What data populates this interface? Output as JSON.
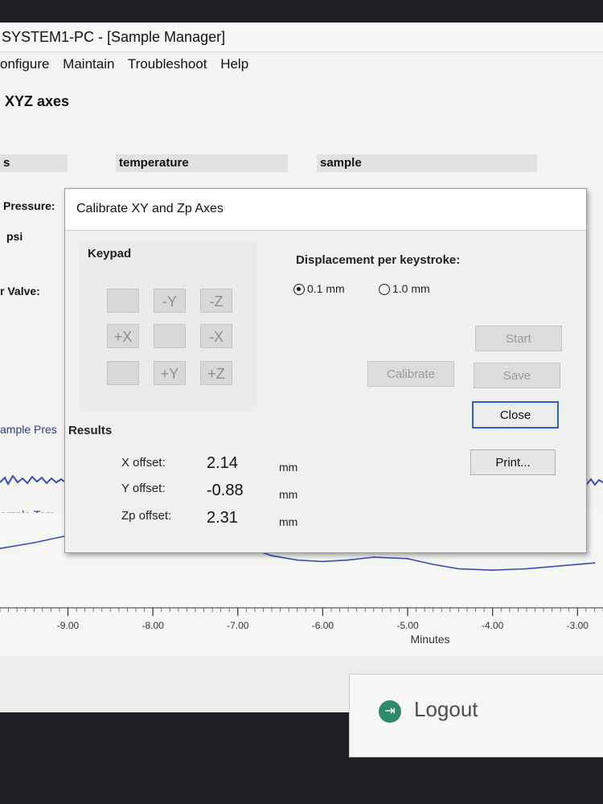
{
  "window": {
    "title": "SYSTEM1-PC - [Sample Manager]"
  },
  "menu": {
    "items": [
      "onfigure",
      "Maintain",
      "Troubleshoot",
      "Help"
    ]
  },
  "page": {
    "heading": "XYZ axes"
  },
  "columns": {
    "left": "s",
    "temperature": "temperature",
    "sample": "sample"
  },
  "side": {
    "pressure_label": "Pressure:",
    "psi_label": "psi",
    "valve_label": "r Valve:",
    "sample_pres": "ample Pres",
    "sample_temp": "ample Tem"
  },
  "chart_data": {
    "type": "line",
    "xlabel": "Minutes",
    "xlim": [
      -9.8,
      -2.7
    ],
    "x_ticks": [
      "-9.00",
      "-8.00",
      "-7.00",
      "-6.00",
      "-5.00",
      "-4.00",
      "-3.00"
    ],
    "series": [
      {
        "x": [
          -9.8,
          -9.4,
          -9.0,
          -8.6,
          -8.2,
          -7.8,
          -7.4,
          -7.0,
          -6.6,
          -6.3,
          -6.0,
          -5.7,
          -5.4,
          -5.0,
          -4.7,
          -4.4,
          -4.0,
          -3.6,
          -3.2,
          -2.8
        ],
        "y": [
          0.62,
          0.7,
          0.8,
          0.86,
          0.88,
          0.86,
          0.8,
          0.68,
          0.52,
          0.46,
          0.44,
          0.46,
          0.5,
          0.48,
          0.4,
          0.34,
          0.32,
          0.34,
          0.38,
          0.42
        ]
      }
    ]
  },
  "dialog": {
    "title": "Calibrate XY and Zp Axes",
    "keypad_label": "Keypad",
    "keys": {
      "minus_y": "-Y",
      "minus_z": "-Z",
      "plus_x": "+X",
      "minus_x": "-X",
      "plus_y": "+Y",
      "plus_z": "+Z"
    },
    "displacement_label": "Displacement per keystroke:",
    "radio_small": "0.1 mm",
    "radio_large": "1.0 mm",
    "start": "Start",
    "calibrate": "Calibrate",
    "save": "Save",
    "close": "Close",
    "print": "Print...",
    "results_label": "Results",
    "results": {
      "x_name": "X offset:",
      "x_val": "2.14",
      "x_unit": "mm",
      "y_name": "Y offset:",
      "y_val": "-0.88",
      "y_unit": "mm",
      "zp_name": "Zp offset:",
      "zp_val": "2.31",
      "zp_unit": "mm"
    }
  },
  "logout": {
    "label": "Logout"
  },
  "colors": {
    "trace": "#3a4fb0",
    "accent": "#2a63c4",
    "logout_icon": "#2f8a6a"
  }
}
